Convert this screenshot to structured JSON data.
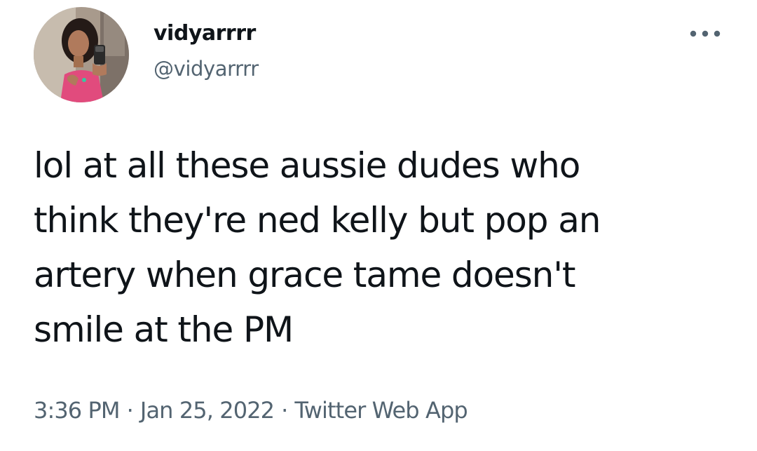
{
  "tweet": {
    "author": {
      "display_name": "vidyarrrr",
      "handle": "@vidyarrrr",
      "avatar_icon": "profile-photo"
    },
    "more_icon": "more-options-icon",
    "text": "lol at all these aussie dudes who\nthink they're ned kelly but pop an\nartery when grace tame doesn't\nsmile at the PM",
    "time": "3:36 PM",
    "separator": "·",
    "date": "Jan 25, 2022",
    "source": "Twitter Web App"
  },
  "colors": {
    "primary_text": "#0f1419",
    "secondary_text": "#536471",
    "background": "#ffffff"
  }
}
